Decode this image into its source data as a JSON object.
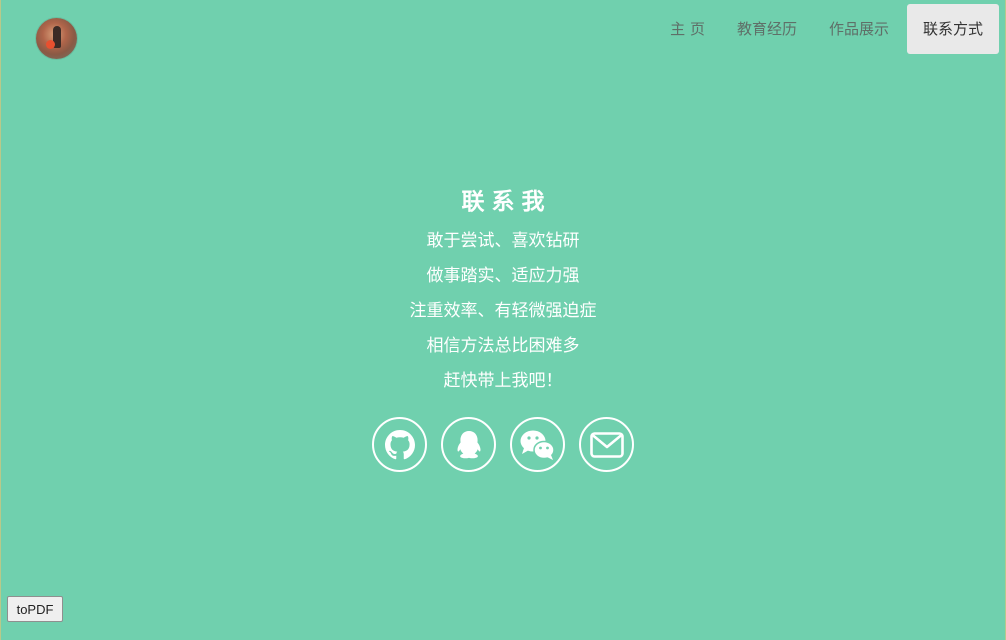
{
  "nav": {
    "items": [
      {
        "label": "主 页",
        "active": false
      },
      {
        "label": "教育经历",
        "active": false
      },
      {
        "label": "作品展示",
        "active": false
      },
      {
        "label": "联系方式",
        "active": true
      }
    ]
  },
  "contact": {
    "title": "联系我",
    "lines": [
      "敢于尝试、喜欢钻研",
      "做事踏实、适应力强",
      "注重效率、有轻微强迫症",
      "相信方法总比困难多",
      "赶快带上我吧！"
    ],
    "icons": [
      "github-icon",
      "qq-icon",
      "wechat-icon",
      "email-icon"
    ]
  },
  "buttons": {
    "topdf_label": "toPDF"
  },
  "colors": {
    "background": "#70d0ae",
    "text": "#ffffff",
    "nav_text": "#5f6f68",
    "nav_active_bg": "#e9e9e9"
  }
}
